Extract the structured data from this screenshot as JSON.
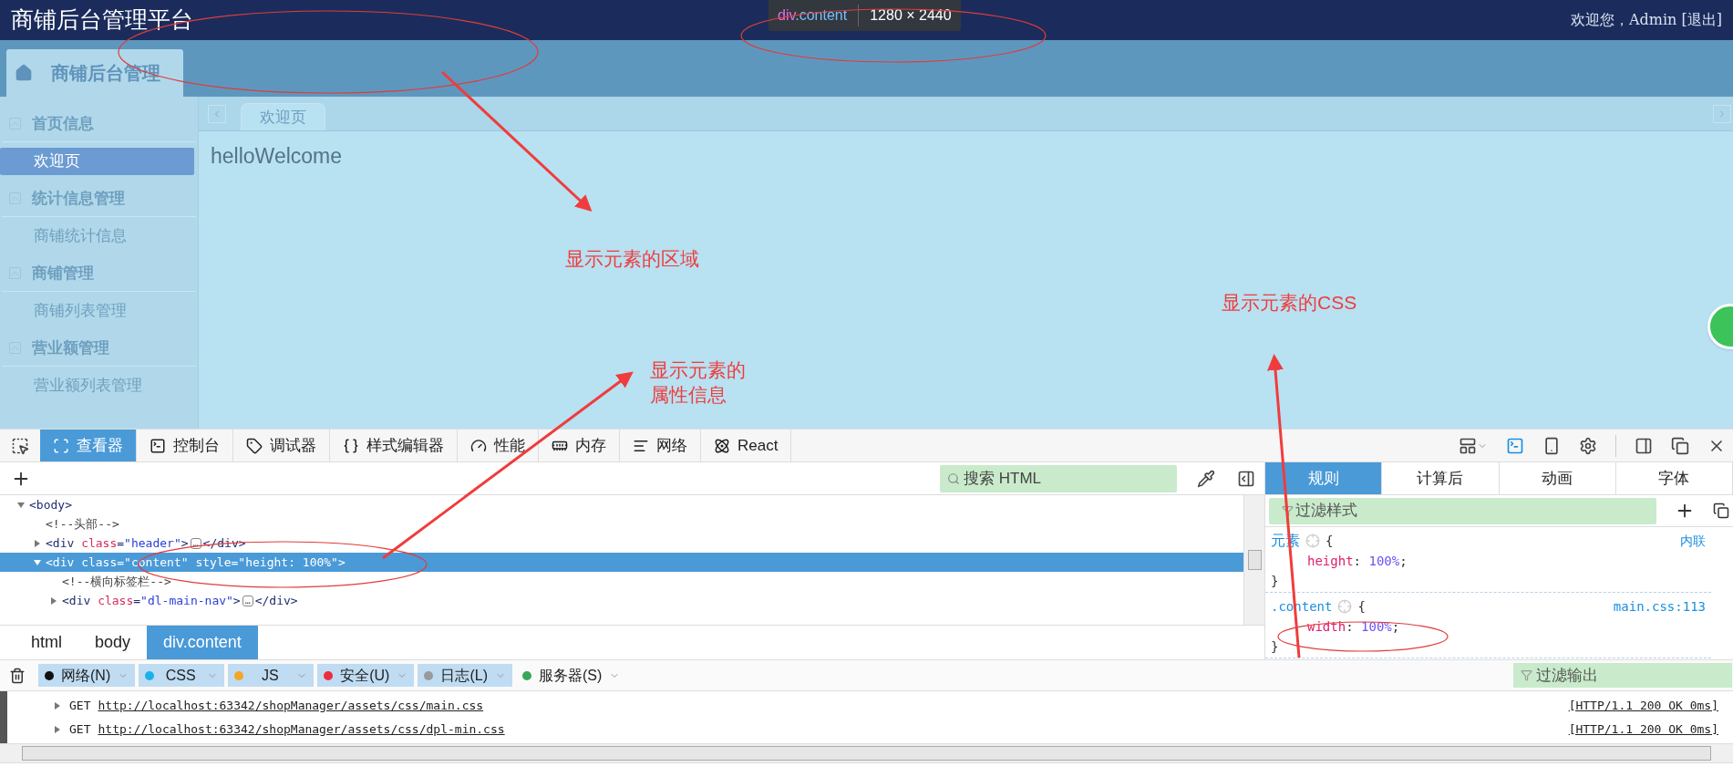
{
  "app": {
    "title": "商铺后台管理平台",
    "user": "欢迎您，Admin [退出]"
  },
  "highlight_tooltip": {
    "tag": "div",
    "cls": ".content",
    "size": "1280 × 2440"
  },
  "nav_tab": {
    "label": "商铺后台管理"
  },
  "sidebar": [
    {
      "title": "首页信息",
      "items": [
        {
          "label": "欢迎页",
          "selected": true
        }
      ]
    },
    {
      "title": "统计信息管理",
      "items": [
        {
          "label": "商铺统计信息",
          "selected": false
        }
      ]
    },
    {
      "title": "商铺管理",
      "items": [
        {
          "label": "商铺列表管理",
          "selected": false
        }
      ]
    },
    {
      "title": "营业额管理",
      "items": [
        {
          "label": "营业额列表管理",
          "selected": false
        }
      ]
    }
  ],
  "page_tabs": [
    {
      "label": "欢迎页",
      "selected": true
    }
  ],
  "content": {
    "text": "helloWelcome"
  },
  "annotations": [
    {
      "text": "显示元素的区域"
    },
    {
      "text": "显示元素的"
    },
    {
      "text": "属性信息"
    },
    {
      "text": "显示元素的CSS"
    }
  ],
  "devtools": {
    "tools": [
      {
        "label": "查看器",
        "selected": true
      },
      {
        "label": "控制台",
        "selected": false
      },
      {
        "label": "调试器",
        "selected": false
      },
      {
        "label": "样式编辑器",
        "selected": false
      },
      {
        "label": "性能",
        "selected": false
      },
      {
        "label": "内存",
        "selected": false
      },
      {
        "label": "网络",
        "selected": false
      },
      {
        "label": "React",
        "selected": false
      }
    ],
    "search": {
      "placeholder": "搜索 HTML"
    },
    "tree": [
      {
        "expanded": true,
        "selected": false,
        "tokens": [
          {
            "kind": "tag",
            "t": "<body>"
          }
        ],
        "children": [
          {
            "tokens": [
              {
                "kind": "comment",
                "t": "<!--头部-->"
              }
            ]
          },
          {
            "expanded": false,
            "selected": false,
            "tokens": [
              {
                "kind": "tag",
                "t": "<div"
              },
              {
                "kind": "attr",
                "t": " class"
              },
              {
                "kind": "tag",
                "t": "="
              },
              {
                "kind": "val",
                "t": "\"header\""
              },
              {
                "kind": "tag",
                "t": ">"
              },
              {
                "kind": "more",
                "t": "…"
              },
              {
                "kind": "tag",
                "t": "</div>"
              }
            ]
          },
          {
            "expanded": true,
            "selected": true,
            "tokens": [
              {
                "kind": "tag",
                "t": "<div"
              },
              {
                "kind": "attr",
                "t": " class"
              },
              {
                "kind": "tag",
                "t": "="
              },
              {
                "kind": "val",
                "t": "\"content\""
              },
              {
                "kind": "attr",
                "t": " style"
              },
              {
                "kind": "tag",
                "t": "="
              },
              {
                "kind": "val",
                "t": "\"height: 100%\""
              },
              {
                "kind": "tag",
                "t": ">"
              }
            ],
            "children": [
              {
                "tokens": [
                  {
                    "kind": "comment",
                    "t": "<!--横向标签栏-->"
                  }
                ]
              },
              {
                "expanded": false,
                "selected": false,
                "tokens": [
                  {
                    "kind": "tag",
                    "t": "<div"
                  },
                  {
                    "kind": "attr",
                    "t": " class"
                  },
                  {
                    "kind": "tag",
                    "t": "="
                  },
                  {
                    "kind": "val",
                    "t": "\"dl-main-nav\""
                  },
                  {
                    "kind": "tag",
                    "t": ">"
                  },
                  {
                    "kind": "more",
                    "t": "…"
                  },
                  {
                    "kind": "tag",
                    "t": "</div>"
                  }
                ]
              }
            ]
          }
        ]
      }
    ],
    "breadcrumbs": [
      {
        "label": "html",
        "selected": false
      },
      {
        "label": "body",
        "selected": false
      },
      {
        "label": "div.content",
        "selected": true
      }
    ],
    "side_tabs": [
      {
        "label": "规则",
        "selected": true
      },
      {
        "label": "计算后",
        "selected": false
      },
      {
        "label": "动画",
        "selected": false
      },
      {
        "label": "字体",
        "selected": false
      }
    ],
    "filter_styles": {
      "placeholder": "过滤样式"
    },
    "rules": [
      {
        "selector": "元素",
        "kind": "element",
        "open": "{",
        "close": "}",
        "source": "内联",
        "decls": [
          {
            "prop": "height",
            "sep": ":",
            "value": "100%",
            "end": ";"
          }
        ]
      },
      {
        "selector": ".content",
        "kind": "class",
        "open": "{",
        "close": "}",
        "source": "main.css:113",
        "decls": [
          {
            "prop": "width",
            "sep": ":",
            "value": "100%",
            "end": ";"
          }
        ]
      }
    ]
  },
  "console": {
    "filters": [
      {
        "label": "网络(N)",
        "color": "#111111",
        "on": true
      },
      {
        "label": "CSS",
        "color": "#1ab2e8",
        "on": true
      },
      {
        "label": "JS",
        "color": "#f5a623",
        "on": true
      },
      {
        "label": "安全(U)",
        "color": "#ed2f3b",
        "on": true
      },
      {
        "label": "日志(L)",
        "color": "#9a9a9a",
        "on": true
      },
      {
        "label": "服务器(S)",
        "color": "#3aa757",
        "on": false
      }
    ],
    "filter_output": {
      "placeholder": "过滤输出"
    },
    "rows": [
      {
        "method": "GET",
        "url": "http://localhost:63342/shopManager/assets/css/main.css",
        "status": "[HTTP/1.1 200 OK 0ms]"
      },
      {
        "method": "GET",
        "url": "http://localhost:63342/shopManager/assets/css/dpl-min.css",
        "status": "[HTTP/1.1 200 OK 0ms]"
      }
    ]
  }
}
